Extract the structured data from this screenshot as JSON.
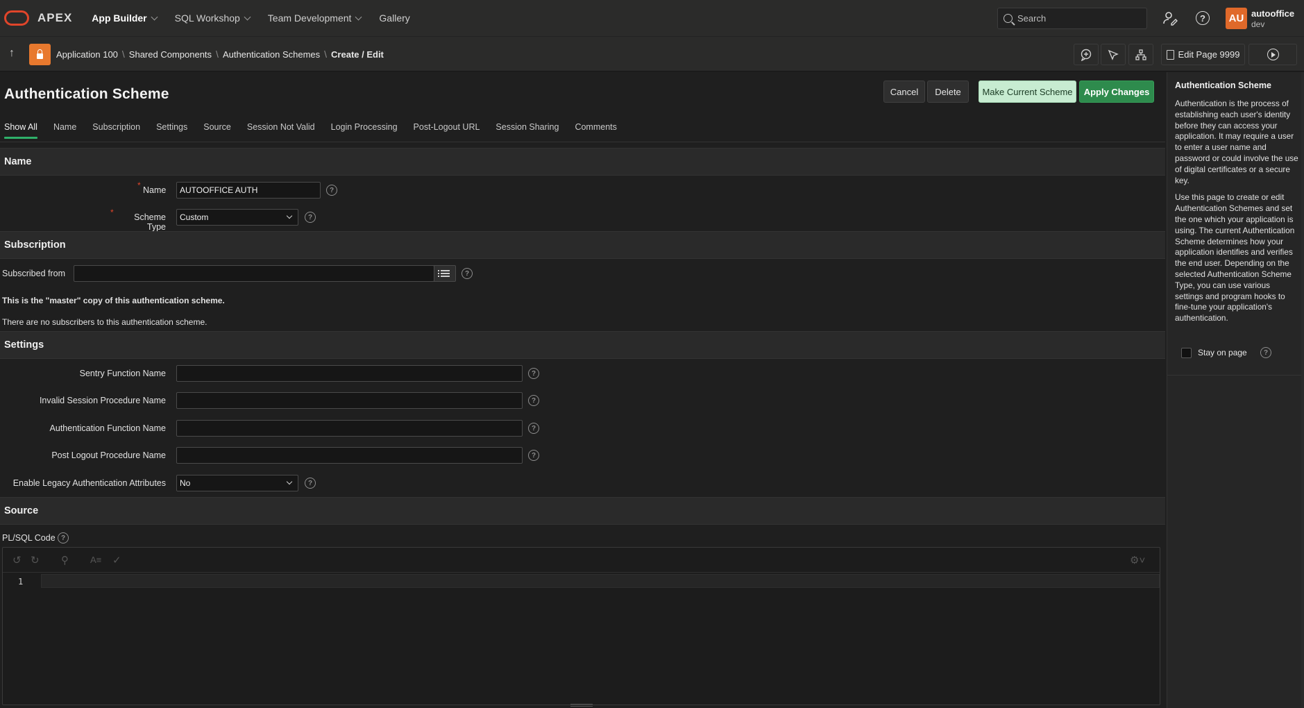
{
  "topnav": {
    "brand": "APEX",
    "items": [
      {
        "label": "App Builder",
        "active": true
      },
      {
        "label": "SQL Workshop"
      },
      {
        "label": "Team Development"
      },
      {
        "label": "Gallery"
      }
    ],
    "search_placeholder": "Search",
    "user": {
      "initials": "AU",
      "name": "autooffice",
      "workspace": "dev"
    },
    "icons": [
      "apex-logo-icon",
      "chevron-down-icon",
      "search-icon",
      "user-admin-icon",
      "help-icon"
    ]
  },
  "breadcrumb": {
    "items": [
      "Application 100",
      "Shared Components",
      "Authentication Schemes",
      "Create / Edit"
    ],
    "edit_page_label": "Edit Page 9999",
    "tool_icons": [
      "comment-add-icon",
      "shared-components-icon",
      "developer-toolbar-icon",
      "run-page-icon"
    ]
  },
  "page": {
    "title": "Authentication Scheme",
    "buttons": {
      "cancel": "Cancel",
      "delete": "Delete",
      "make_current": "Make Current Scheme",
      "apply": "Apply Changes"
    },
    "tabs": [
      "Show All",
      "Name",
      "Subscription",
      "Settings",
      "Source",
      "Session Not Valid",
      "Login Processing",
      "Post-Logout URL",
      "Session Sharing",
      "Comments"
    ],
    "active_tab": "Show All"
  },
  "sections": {
    "name": {
      "heading": "Name",
      "name_label": "Name",
      "name_value": "AUTOOFFICE AUTH",
      "scheme_type_label": "Scheme Type",
      "scheme_type_value": "Custom"
    },
    "subscription": {
      "heading": "Subscription",
      "subscribed_from_label": "Subscribed from",
      "subscribed_from_value": "",
      "master_note": "This is the \"master\" copy of this authentication scheme.",
      "no_subscribers_note": "There are no subscribers to this authentication scheme."
    },
    "settings": {
      "heading": "Settings",
      "sentry_label": "Sentry Function Name",
      "sentry_value": "",
      "invalid_session_label": "Invalid Session Procedure Name",
      "invalid_session_value": "",
      "auth_function_label": "Authentication Function Name",
      "auth_function_value": "",
      "post_logout_label": "Post Logout Procedure Name",
      "post_logout_value": "",
      "legacy_label": "Enable Legacy Authentication Attributes",
      "legacy_value": "No"
    },
    "source": {
      "heading": "Source",
      "plsql_label": "PL/SQL Code",
      "line_number": "1",
      "editor_icons": [
        "undo-icon",
        "redo-icon",
        "find-icon",
        "format-icon",
        "validate-icon",
        "settings-icon"
      ]
    }
  },
  "help": {
    "title": "Authentication Scheme",
    "para1": "Authentication is the process of establishing each user's identity before they can access your application. It may require a user to enter a user name and password or could involve the use of digital certificates or a secure key.",
    "para2": "Use this page to create or edit Authentication Schemes and set the one which your application is using. The current Authentication Scheme determines how your application identifies and verifies the end user. Depending on the selected Authentication Scheme Type, you can use various settings and program hooks to fine-tune your application's authentication.",
    "stay_on_page_label": "Stay on page",
    "stay_on_page_checked": false
  },
  "colors": {
    "accent_green": "#2e8b4d",
    "light_green": "#c7ecd1",
    "brand_red": "#e0452a",
    "avatar_orange": "#e0692a",
    "app_orange": "#e8792e"
  }
}
